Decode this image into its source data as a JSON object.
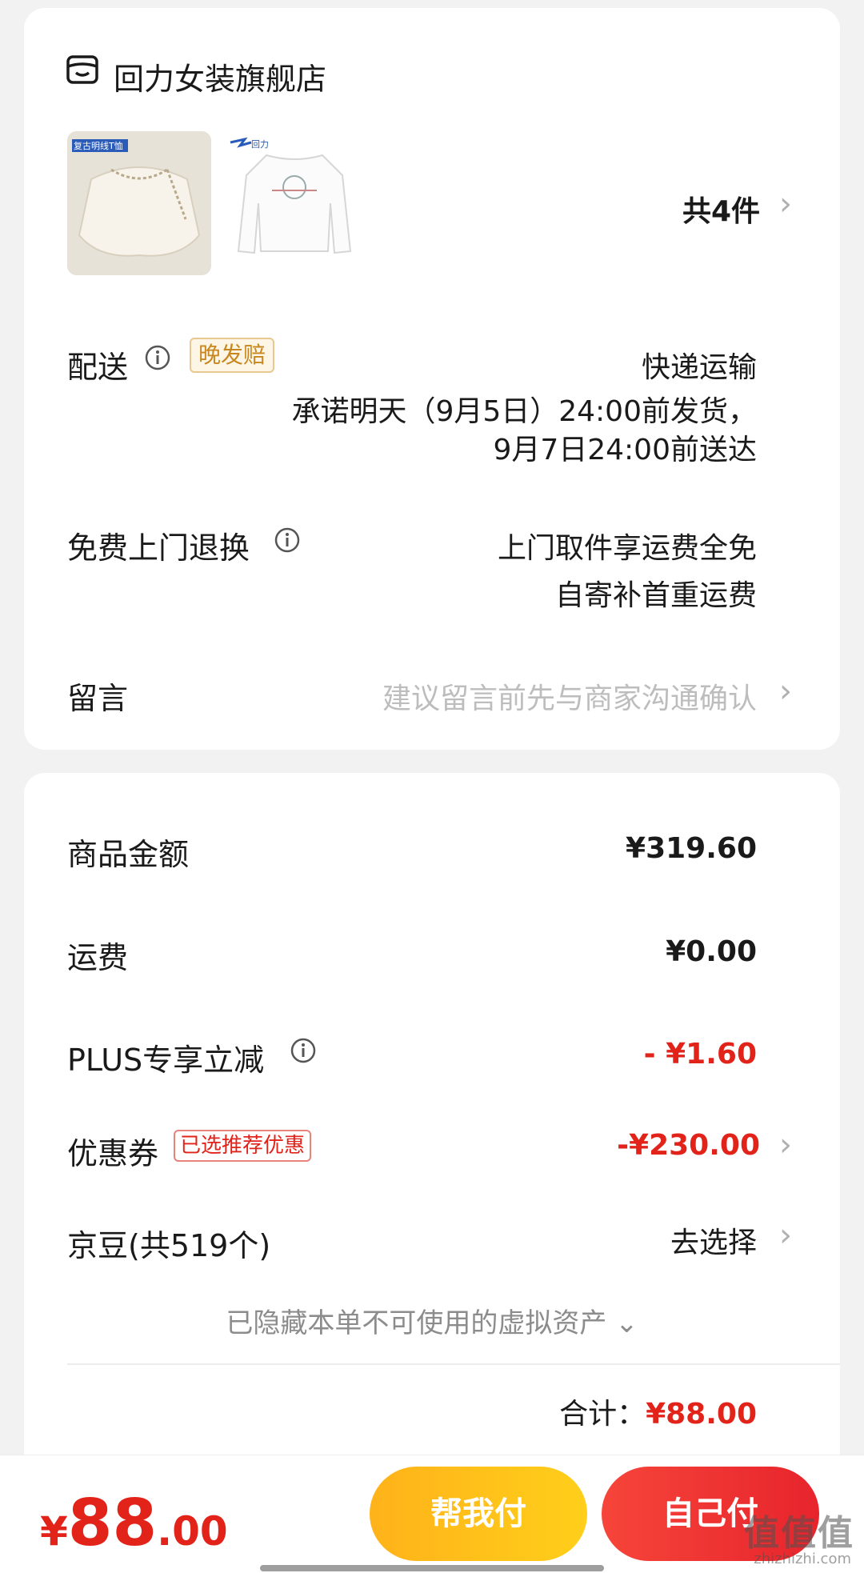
{
  "shop": {
    "name": "回力女装旗舰店",
    "icon": "shop-icon"
  },
  "products": {
    "quantity": "共4件",
    "thumb1_badge": "复古明线T恤",
    "thumb2_logo": "回力"
  },
  "delivery": {
    "label": "配送",
    "badge": "晚发赔",
    "method": "快递运输",
    "line1": "承诺明天（9月5日）24:00前发货，",
    "line2": "9月7日24:00前送达"
  },
  "returns": {
    "label": "免费上门退换",
    "line1": "上门取件享运费全免",
    "line2": "自寄补首重运费"
  },
  "message": {
    "label": "留言",
    "placeholder": "建议留言前先与商家沟通确认"
  },
  "amounts": {
    "goods_label": "商品金额",
    "goods_value": "¥319.60",
    "shipping_label": "运费",
    "shipping_value": "¥0.00",
    "plus_label": "PLUS专享立减",
    "plus_value": "- ¥1.60",
    "coupon_label": "优惠券",
    "coupon_badge": "已选推荐优惠",
    "coupon_value": "-¥230.00",
    "bean_label": "京豆(共519个)",
    "bean_value": "去选择",
    "hidden_assets": "已隐藏本单不可使用的虚拟资产 ⌄",
    "total_label": "合计：",
    "total_value": "¥88.00"
  },
  "bottom": {
    "pay_symbol": "¥",
    "pay_int": "88",
    "pay_dec": ".00",
    "help_pay": "帮我付",
    "self_pay": "自己付"
  },
  "watermark": {
    "text": "值值值",
    "sub": "zhizhizhi.com"
  },
  "colors": {
    "accent_red": "#e2231a",
    "help_yellow": "#ffc11a",
    "badge_gold": "#c8871e"
  }
}
